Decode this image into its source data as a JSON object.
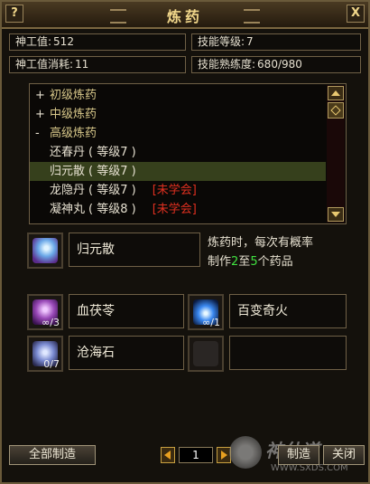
{
  "window": {
    "title": "炼药",
    "help_label": "?",
    "close_label": "X"
  },
  "stats": {
    "shengong_label": "神工值:",
    "shengong_value": "512",
    "consume_label": "神工值消耗:",
    "consume_value": "11",
    "skill_level_label": "技能等级:",
    "skill_level_value": "7",
    "proficiency_label": "技能熟练度:",
    "proficiency_value": "680/980"
  },
  "recipe_list": {
    "rows": [
      {
        "type": "category",
        "sign": "+",
        "name": "初级炼药"
      },
      {
        "type": "category",
        "sign": "+",
        "name": "中级炼药"
      },
      {
        "type": "category",
        "sign": "-",
        "name": "高级炼药"
      },
      {
        "type": "item",
        "name": "还春丹",
        "level": "( 等级7 )",
        "status": ""
      },
      {
        "type": "item",
        "name": "归元散",
        "level": "( 等级7 )",
        "status": "",
        "selected": true
      },
      {
        "type": "item",
        "name": "龙隐丹",
        "level": "( 等级7 )",
        "status": "[未学会]"
      },
      {
        "type": "item",
        "name": "凝神丸",
        "level": "( 等级8 )",
        "status": "[未学会]"
      }
    ]
  },
  "selected": {
    "name": "归元散",
    "icon": "crystal-potion-icon",
    "desc_line1": "炼药时，每次有概率",
    "desc_pre": "制作",
    "desc_min": "2",
    "desc_mid": "至",
    "desc_max": "5",
    "desc_post": "个药品"
  },
  "materials": [
    {
      "name": "血茯苓",
      "count": "∞/3",
      "icon": "purple-herb-icon"
    },
    {
      "name": "百变奇火",
      "count": "∞/1",
      "icon": "blue-flame-icon"
    },
    {
      "name": "沧海石",
      "count": "0/7",
      "icon": "blue-stone-icon"
    },
    {
      "name": "",
      "count": "",
      "icon": "empty-slot-icon"
    }
  ],
  "bottom": {
    "make_all_label": "全部制造",
    "quantity": "1",
    "make_label": "制造",
    "close_label": "关闭"
  },
  "watermark": {
    "text": "神仙道",
    "url": "WWW.SXDS.COM"
  },
  "colors": {
    "accent": "#f0d68a",
    "selected_row": "#36401c",
    "unlearned": "#e03020",
    "highlight_number": "#40e040"
  }
}
